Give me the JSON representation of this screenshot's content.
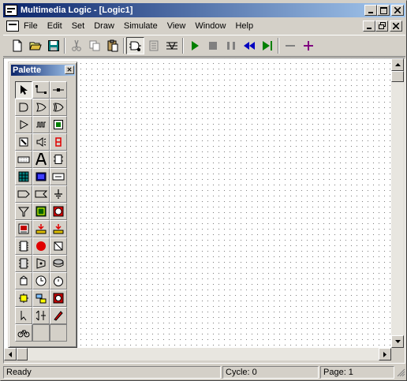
{
  "window": {
    "title": "Multimedia Logic - [Logic1]",
    "caption_buttons": [
      "minimize",
      "maximize",
      "close"
    ]
  },
  "menubar": {
    "items": [
      "File",
      "Edit",
      "Set",
      "Draw",
      "Simulate",
      "View",
      "Window",
      "Help"
    ]
  },
  "toolbar": {
    "buttons": [
      "new",
      "open",
      "save",
      "cut",
      "copy",
      "paste",
      "simulate-mode",
      "draw-mode",
      "wire-mode",
      "run",
      "stop",
      "pause",
      "step-back",
      "step-forward",
      "zoom-out",
      "zoom-in"
    ]
  },
  "palette": {
    "title": "Palette",
    "close_glyph": "✕",
    "tools": [
      "select-arrow",
      "wire-tool",
      "connector",
      "and-gate",
      "or-gate",
      "xor-gate",
      "buffer",
      "clock-wave",
      "led",
      "switch",
      "speaker",
      "seven-segment",
      "keyboard",
      "text",
      "flip-flop",
      "bitmap",
      "screen",
      "register",
      "tag-input",
      "tag-output",
      "ground",
      "filter",
      "chip",
      "timer-box",
      "printer",
      "adder",
      "ram",
      "rom",
      "red-led",
      "counter",
      "dip-chip",
      "decoder",
      "dial",
      "mux",
      "clock-face",
      "stopwatch",
      "yellow-node",
      "network",
      "sound",
      "pointer",
      "demux",
      "pen",
      "bicycle"
    ]
  },
  "status": {
    "ready": "Ready",
    "cycle": "Cycle: 0",
    "page": "Page: 1"
  },
  "colors": {
    "title_gradient_start": "#0a246a",
    "title_gradient_end": "#a6caf0",
    "chrome": "#d4d0c8",
    "run_green": "#008000",
    "step_blue": "#0000c0",
    "zoom_purple": "#800080"
  }
}
